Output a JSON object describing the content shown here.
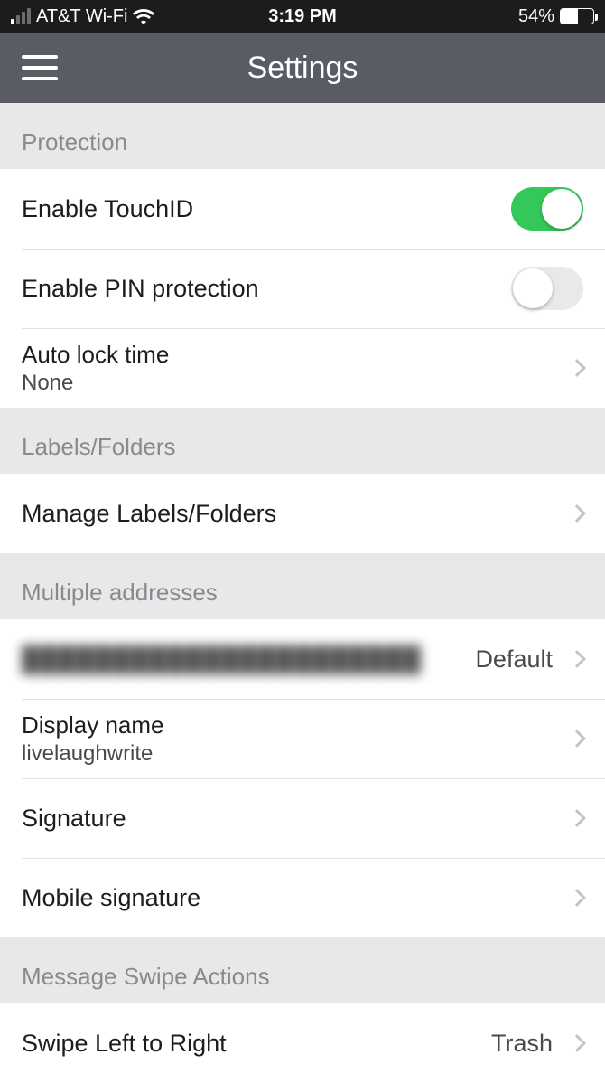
{
  "status": {
    "carrier": "AT&T Wi-Fi",
    "time": "3:19 PM",
    "battery_pct": "54%"
  },
  "nav": {
    "title": "Settings"
  },
  "sections": {
    "protection": {
      "header": "Protection",
      "touchid_label": "Enable TouchID",
      "pin_label": "Enable PIN protection",
      "autolock_title": "Auto lock time",
      "autolock_value": "None"
    },
    "labels": {
      "header": "Labels/Folders",
      "manage_label": "Manage Labels/Folders"
    },
    "addresses": {
      "header": "Multiple addresses",
      "default_address_text": "██████████████████████",
      "default_badge": "Default",
      "display_name_title": "Display name",
      "display_name_value": "livelaughwrite",
      "signature_label": "Signature",
      "mobile_signature_label": "Mobile signature"
    },
    "swipe": {
      "header": "Message Swipe Actions",
      "left_to_right_label": "Swipe Left to Right",
      "left_to_right_value": "Trash"
    }
  }
}
